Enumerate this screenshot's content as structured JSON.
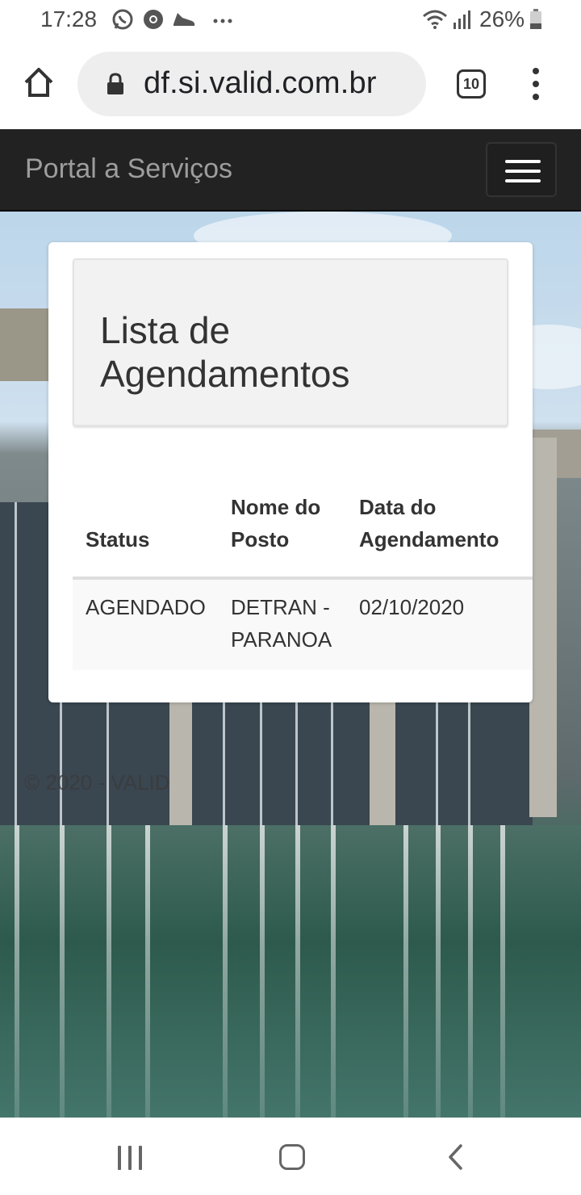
{
  "status_bar": {
    "time": "17:28",
    "battery": "26%",
    "left_icons": [
      "whatsapp-icon",
      "chrome-icon",
      "shoe-icon",
      "more-dots-icon"
    ],
    "right_icons": [
      "wifi-icon",
      "signal-icon",
      "battery-icon"
    ]
  },
  "browser": {
    "url": "df.si.valid.com.br",
    "tab_count": "10"
  },
  "navbar": {
    "brand": "Portal a Serviços"
  },
  "page": {
    "heading": "Lista de Agendamentos",
    "table": {
      "headers": [
        "Status",
        "Nome do Posto",
        "Data do Agendamento"
      ],
      "rows": [
        {
          "status": "AGENDADO",
          "posto": "DETRAN - PARANOA",
          "data": "02/10/2020"
        }
      ]
    },
    "footer": "© 2020 - VALID"
  },
  "colors": {
    "navbar_bg": "#222222",
    "brand_text": "#9d9d9d",
    "card_bg": "#ffffff",
    "jumbotron_bg": "#f2f2f2"
  }
}
